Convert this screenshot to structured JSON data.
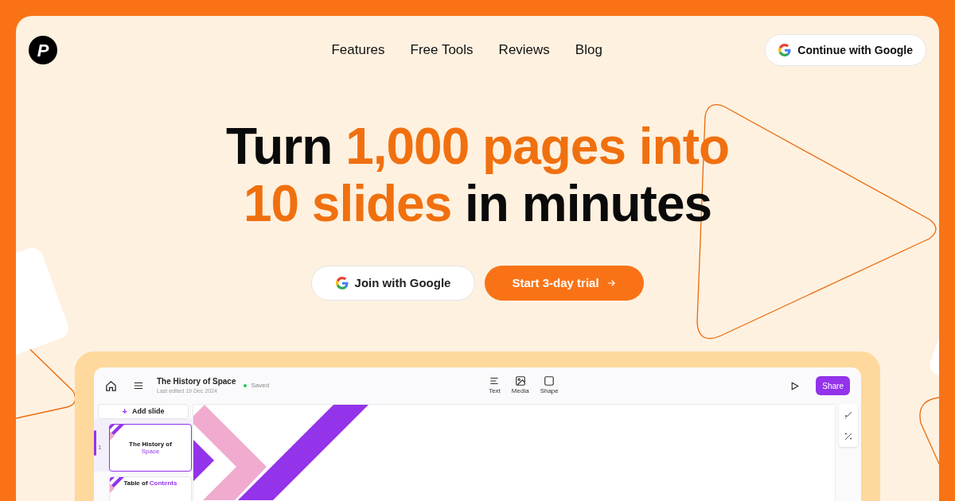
{
  "logo": {
    "letter": "P"
  },
  "nav": {
    "links": [
      {
        "label": "Features"
      },
      {
        "label": "Free Tools"
      },
      {
        "label": "Reviews"
      },
      {
        "label": "Blog"
      }
    ],
    "cta": "Continue with Google"
  },
  "hero": {
    "lines": [
      [
        {
          "text": "Turn ",
          "accent": false
        },
        {
          "text": "1,000 pages into",
          "accent": true
        }
      ],
      [
        {
          "text": "10 slides",
          "accent": true
        },
        {
          "text": " in minutes",
          "accent": false
        }
      ]
    ],
    "buttons": [
      {
        "kind": "google",
        "label": "Join with Google"
      },
      {
        "kind": "primary",
        "label": "Start 3-day trial"
      }
    ]
  },
  "editor": {
    "title": "The History of Space",
    "subtitle": "Last edited 19 Dec 2024",
    "status": "Saved",
    "tools": [
      {
        "kind": "text",
        "label": "Text"
      },
      {
        "kind": "media",
        "label": "Media"
      },
      {
        "kind": "shape",
        "label": "Shape"
      }
    ],
    "share": "Share",
    "add_slide": "Add slide",
    "add_icon": "+",
    "slides": [
      {
        "number": "1",
        "title": "The History of",
        "accent": "Space",
        "selected": true
      },
      {
        "title": "Table of ",
        "accent": "Contents",
        "selected": false
      }
    ]
  }
}
